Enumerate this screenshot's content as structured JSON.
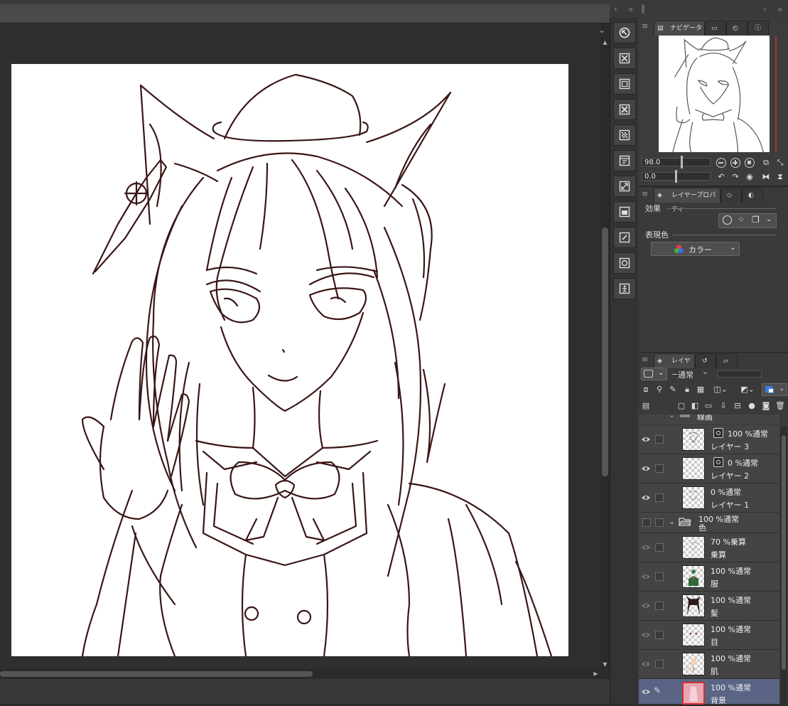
{
  "navigator": {
    "tab_label": "ナビゲーター",
    "zoom_value": "98.0",
    "rotate_value": "0.0"
  },
  "layer_property": {
    "tab_label": "レイヤープロパティ",
    "effect_label": "効果",
    "expression_color_label": "表現色",
    "expression_color_value": "カラー"
  },
  "layers": {
    "tab_label": "レイヤー",
    "blend_mode": "通常",
    "partial_group_label": "線画",
    "rows": [
      {
        "opacity": "100 %通常",
        "name": "レイヤー 3",
        "effect": true,
        "visible": true,
        "selected": false,
        "thumb": "sketch",
        "indent": 1
      },
      {
        "opacity": "0 %通常",
        "name": "レイヤー 2",
        "effect": true,
        "visible": true,
        "selected": false,
        "thumb": "empty",
        "indent": 1
      },
      {
        "opacity": "0 %通常",
        "name": "レイヤー 1",
        "effect": false,
        "visible": true,
        "selected": false,
        "thumb": "sketch",
        "indent": 1
      },
      {
        "opacity": "100 %通常",
        "name": "色",
        "effect": false,
        "visible": false,
        "selected": false,
        "thumb": "folder",
        "indent": 0
      },
      {
        "opacity": "70 %乗算",
        "name": "乗算",
        "effect": false,
        "visible": false,
        "selected": false,
        "thumb": "sketch",
        "indent": 1
      },
      {
        "opacity": "100 %通常",
        "name": "服",
        "effect": false,
        "visible": false,
        "selected": false,
        "thumb": "clothes",
        "indent": 1
      },
      {
        "opacity": "100 %通常",
        "name": "髪",
        "effect": false,
        "visible": false,
        "selected": false,
        "thumb": "hair",
        "indent": 1
      },
      {
        "opacity": "100 %通常",
        "name": "目",
        "effect": false,
        "visible": false,
        "selected": false,
        "thumb": "eyes",
        "indent": 1
      },
      {
        "opacity": "100 %通常",
        "name": "肌",
        "effect": false,
        "visible": false,
        "selected": false,
        "thumb": "skin",
        "indent": 1
      },
      {
        "opacity": "100 %通常",
        "name": "背景",
        "effect": false,
        "visible": true,
        "selected": true,
        "thumb": "bg",
        "indent": 1
      }
    ]
  },
  "colors": {
    "lineart": "#3a1616",
    "selected_row": "#5a6585",
    "panel_bg": "#3a3a3a"
  }
}
